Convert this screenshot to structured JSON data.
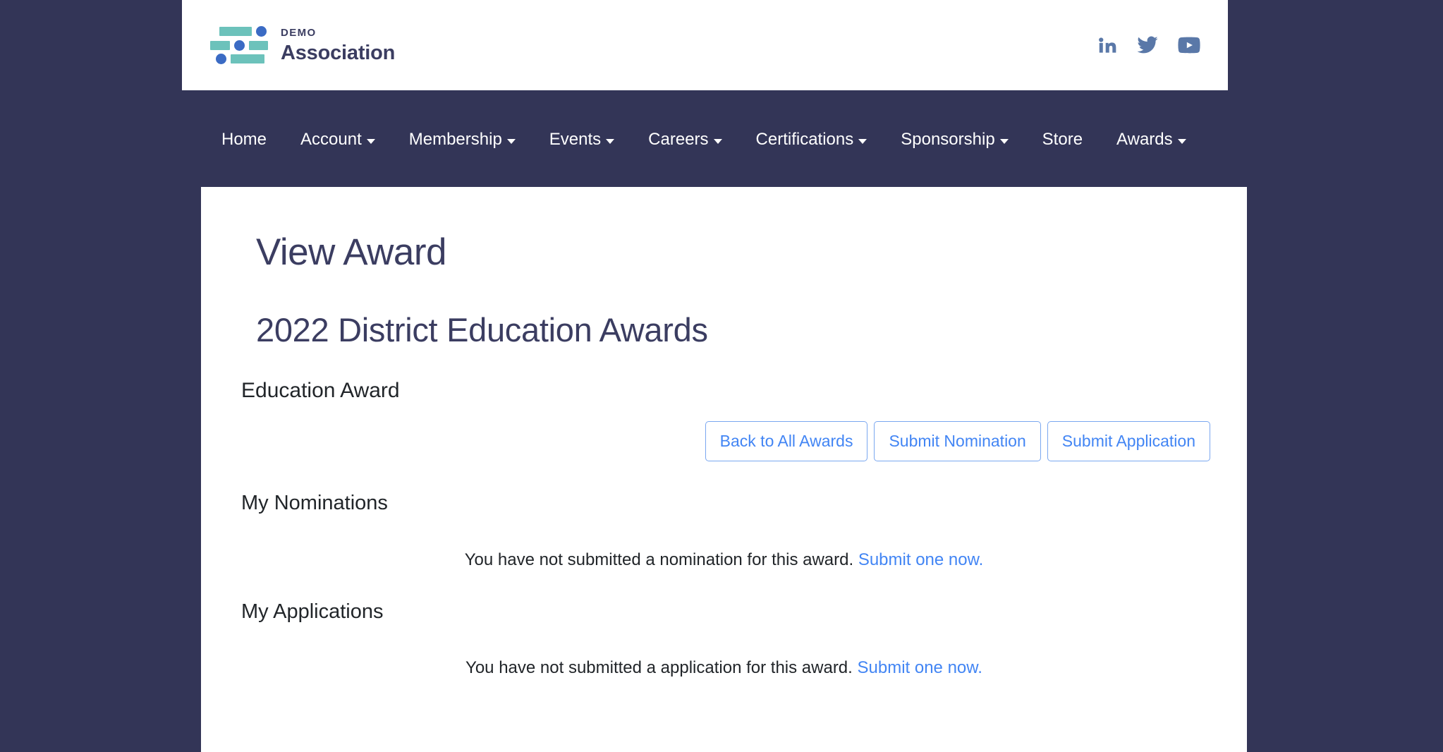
{
  "header": {
    "brand": {
      "eyebrow": "DEMO",
      "name": "Association",
      "logo_icon": "association-bars-logo-icon"
    },
    "social": [
      {
        "name": "linkedin-icon",
        "label": "LinkedIn"
      },
      {
        "name": "twitter-icon",
        "label": "Twitter"
      },
      {
        "name": "youtube-icon",
        "label": "YouTube"
      }
    ],
    "social_color": "#5a78a8",
    "logo_bar_color": "#6cc2bb",
    "logo_dot_color": "#3b6bc4"
  },
  "nav": {
    "items": [
      {
        "label": "Home",
        "has_dropdown": false
      },
      {
        "label": "Account",
        "has_dropdown": true
      },
      {
        "label": "Membership",
        "has_dropdown": true
      },
      {
        "label": "Events",
        "has_dropdown": true
      },
      {
        "label": "Careers",
        "has_dropdown": true
      },
      {
        "label": "Certifications",
        "has_dropdown": true
      },
      {
        "label": "Sponsorship",
        "has_dropdown": true
      },
      {
        "label": "Store",
        "has_dropdown": false
      },
      {
        "label": "Awards",
        "has_dropdown": true
      }
    ],
    "background": "#333557",
    "text_color": "#ffffff"
  },
  "main": {
    "page_title": "View Award",
    "award_title": "2022 District Education Awards",
    "award_subtitle": "Education Award",
    "buttons": [
      {
        "label": "Back to All Awards"
      },
      {
        "label": "Submit Nomination"
      },
      {
        "label": "Submit Application"
      }
    ],
    "nominations": {
      "heading": "My Nominations",
      "empty_text": "You have not submitted a nomination for this award.",
      "empty_link": "Submit one now."
    },
    "applications": {
      "heading": "My Applications",
      "empty_text": "You have not submitted a application for this award.",
      "empty_link": "Submit one now."
    },
    "accent_color": "#4285f4",
    "heading_color": "#3b3d61"
  }
}
